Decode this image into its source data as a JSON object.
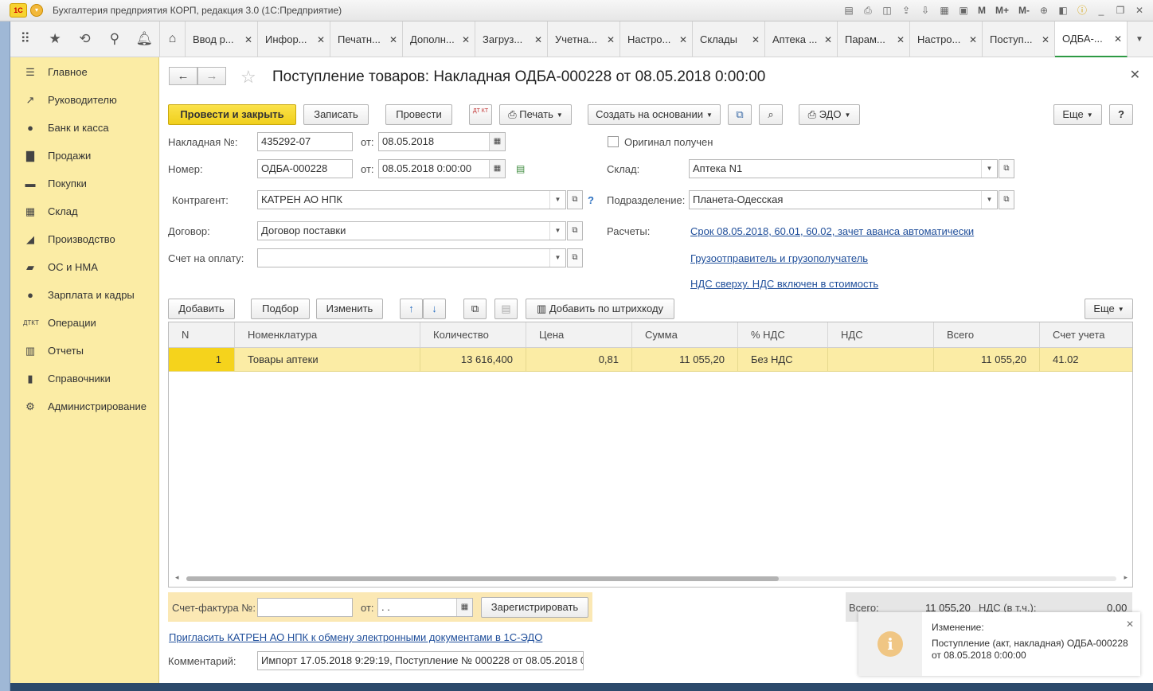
{
  "window": {
    "title": "Бухгалтерия предприятия КОРП, редакция 3.0  (1С:Предприятие)",
    "logo": "1С",
    "toolbar_m": [
      "M",
      "M+",
      "M-"
    ]
  },
  "tabs": [
    {
      "label": "Ввод р..."
    },
    {
      "label": "Инфор..."
    },
    {
      "label": "Печатн..."
    },
    {
      "label": "Дополн..."
    },
    {
      "label": "Загруз..."
    },
    {
      "label": "Учетна..."
    },
    {
      "label": "Настро..."
    },
    {
      "label": "Склады"
    },
    {
      "label": "Аптека ..."
    },
    {
      "label": "Парам..."
    },
    {
      "label": "Настро..."
    },
    {
      "label": "Поступ..."
    },
    {
      "label": "ОДБА-..."
    }
  ],
  "sidebar": {
    "items": [
      {
        "label": "Главное",
        "icon": "menu-icon"
      },
      {
        "label": "Руководителю",
        "icon": "trend-icon"
      },
      {
        "label": "Банк и касса",
        "icon": "ruble-icon"
      },
      {
        "label": "Продажи",
        "icon": "bag-icon"
      },
      {
        "label": "Покупки",
        "icon": "cart-icon"
      },
      {
        "label": "Склад",
        "icon": "warehouse-icon"
      },
      {
        "label": "Производство",
        "icon": "factory-icon"
      },
      {
        "label": "ОС и НМА",
        "icon": "truck-icon"
      },
      {
        "label": "Зарплата и кадры",
        "icon": "person-icon"
      },
      {
        "label": "Операции",
        "icon": "dt-kt-icon"
      },
      {
        "label": "Отчеты",
        "icon": "bar-chart-icon"
      },
      {
        "label": "Справочники",
        "icon": "book-icon"
      },
      {
        "label": "Администрирование",
        "icon": "gear-icon"
      }
    ]
  },
  "document": {
    "title": "Поступление товаров: Накладная ОДБА-000228 от 08.05.2018 0:00:00"
  },
  "toolbar": {
    "post_close": "Провести и закрыть",
    "save": "Записать",
    "post": "Провести",
    "print": "Печать",
    "create_based": "Создать на основании",
    "edo": "ЭДО",
    "more": "Еще",
    "help": "?",
    "dtkt": "ДТ КТ"
  },
  "form": {
    "invoice_no_label": "Накладная №:",
    "invoice_no": "435292-07",
    "from_label": "от:",
    "invoice_date": "08.05.2018",
    "number_label": "Номер:",
    "number": "ОДБА-000228",
    "number_date": "08.05.2018  0:00:00",
    "original_label": "Оригинал получен",
    "warehouse_label": "Склад:",
    "warehouse": "Аптека N1",
    "counterparty_label": "Контрагент:",
    "counterparty": "КАТРЕН АО НПК",
    "question": "?",
    "division_label": "Подразделение:",
    "division": "Планета-Одесская",
    "contract_label": "Договор:",
    "contract": "Договор поставки",
    "settlements_label": "Расчеты:",
    "settlements_link": "Срок 08.05.2018, 60.01, 60.02, зачет аванса автоматически",
    "payment_invoice_label": "Счет на оплату:",
    "payment_invoice": "",
    "shipper_link": "Грузоотправитель и грузополучатель",
    "vat_link": "НДС сверху. НДС включен в стоимость"
  },
  "table_toolbar": {
    "add": "Добавить",
    "pick": "Подбор",
    "edit": "Изменить",
    "barcode": "Добавить по штрихкоду",
    "more": "Еще"
  },
  "table": {
    "columns": [
      "N",
      "Номенклатура",
      "Количество",
      "Цена",
      "Сумма",
      "% НДС",
      "НДС",
      "Всего",
      "Счет учета"
    ],
    "rows": [
      [
        "1",
        "Товары аптеки",
        "13 616,400",
        "0,81",
        "11 055,20",
        "Без НДС",
        "",
        "11 055,20",
        "41.02"
      ]
    ]
  },
  "footer": {
    "invoice_label": "Счет-фактура №:",
    "invoice_value": "",
    "from_label": "от:",
    "invoice_date": " .  .",
    "register": "Зарегистрировать",
    "total_label": "Всего:",
    "total_value": "11 055,20",
    "vat_label": "НДС (в т.ч.):",
    "vat_value": "0,00",
    "edo_link": "Пригласить КАТРЕН АО НПК к обмену электронными документами в 1С-ЭДО",
    "comment_label": "Комментарий:",
    "comment": "Импорт 17.05.2018 9:29:19, Поступление № 000228 от 08.05.2018 0"
  },
  "notification": {
    "title": "Изменение:",
    "text": "Поступление (акт, накладная) ОДБА-000228 от 08.05.2018 0:00:00"
  },
  "colors": {
    "sidebar": "#fbeca5",
    "primary_button": "#f5d31c",
    "link": "#1f4e9a",
    "active_tab_underline": "#2e9a44"
  }
}
